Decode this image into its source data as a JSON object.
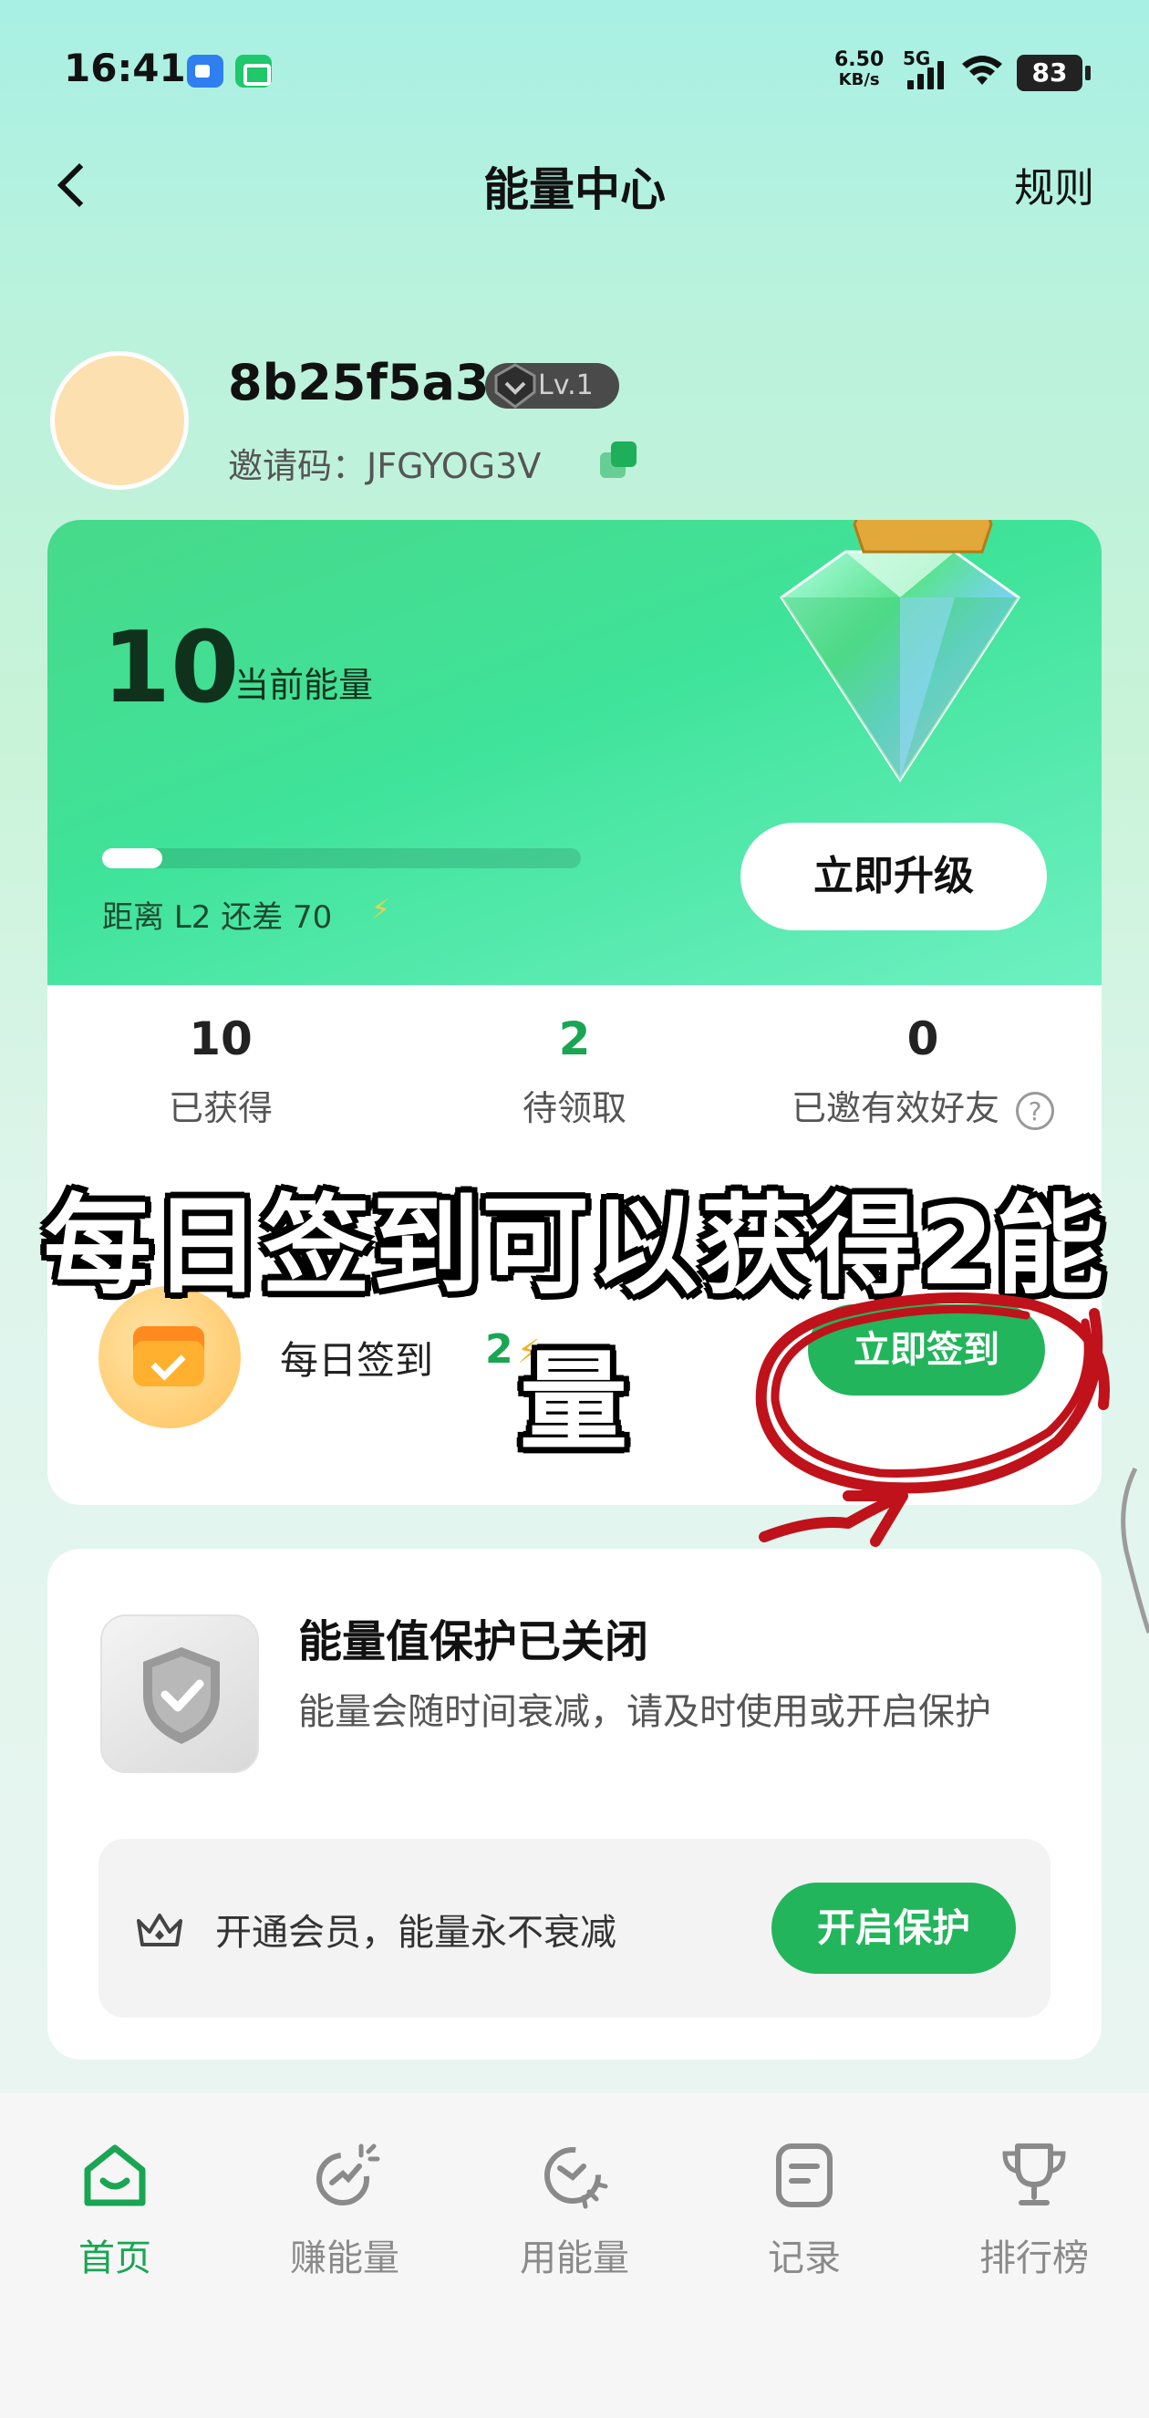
{
  "status_bar": {
    "time": "16:41",
    "net_speed_value": "6.50",
    "net_speed_unit": "KB/s",
    "network": "5G",
    "battery": "83"
  },
  "header": {
    "title": "能量中心",
    "rules": "规则"
  },
  "profile": {
    "username": "8b25f5a3",
    "level": "Lv.1",
    "invite_label": "邀请码：JFGYOG3V"
  },
  "energy": {
    "value": "10",
    "label": "当前能量",
    "progress": 0.125,
    "gap_text": "距离 L2 还差 70",
    "upgrade_button": "立即升级"
  },
  "stats": [
    {
      "value": "10",
      "label": "已获得"
    },
    {
      "value": "2",
      "label": "待领取"
    },
    {
      "value": "0",
      "label": "已邀有效好友"
    }
  ],
  "checkin": {
    "title": "每日签到",
    "reward": "2",
    "button": "立即签到"
  },
  "overlay_caption": "每日签到可以获得2能量",
  "protection": {
    "title": "能量值保护已关闭",
    "description": "能量会随时间衰减，请及时使用或开启保护",
    "banner_text": "开通会员，能量永不衰减",
    "button": "开启保护"
  },
  "nav": [
    {
      "label": "首页",
      "icon": "home-icon",
      "active": true
    },
    {
      "label": "赚能量",
      "icon": "earn-energy-icon",
      "active": false
    },
    {
      "label": "用能量",
      "icon": "use-energy-icon",
      "active": false
    },
    {
      "label": "记录",
      "icon": "records-icon",
      "active": false
    },
    {
      "label": "排行榜",
      "icon": "trophy-icon",
      "active": false
    }
  ],
  "colors": {
    "accent": "#22b55c",
    "annotation": "#c0121a"
  }
}
